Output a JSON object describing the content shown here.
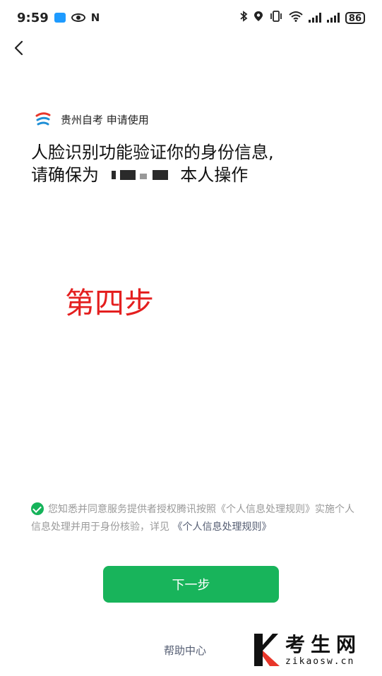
{
  "status_bar": {
    "time": "9:59",
    "battery": "86",
    "nfc_label": "N"
  },
  "app": {
    "name_line": "贵州自考 申请使用"
  },
  "headline": {
    "line1": "人脸识别功能验证你的身份信息,",
    "line2_prefix": "请确保为",
    "line2_suffix": "本人操作"
  },
  "overlay_label": "第四步",
  "consent": {
    "text": "您知悉并同意服务提供者授权腾讯按照《个人信息处理规则》实施个人信息处理并用于身份核验，详见",
    "link": "《个人信息处理规则》"
  },
  "next_button": "下一步",
  "help_center": "帮助中心",
  "watermark": {
    "title": "考生网",
    "domain": "zikaosw.cn"
  },
  "colors": {
    "accent_green": "#18b45b",
    "overlay_red": "#e41f1f",
    "link_blue_gray": "#555e73"
  }
}
